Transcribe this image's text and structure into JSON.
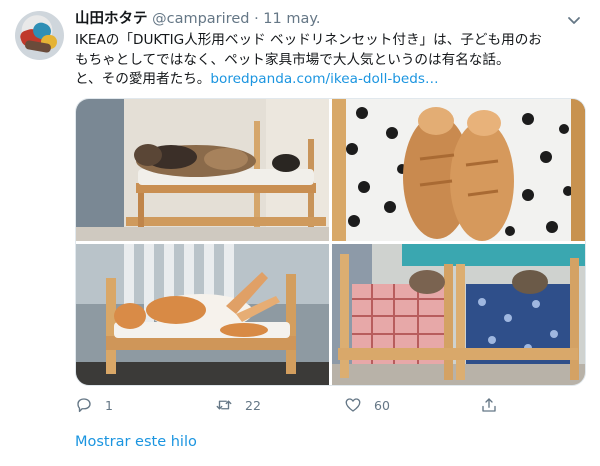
{
  "tweet": {
    "author_name": "山田ホタテ",
    "handle": "@camparired",
    "separator": "·",
    "date": "11 may.",
    "text_lines": [
      "IKEAの「DUKTIG人形用ベッド ベッドリネンセット付き」は、子ども用のお",
      "もちゃとしてではなく、ペット家具市場で大人気というのは有名な話。",
      "と、その愛用者たち。"
    ],
    "link": "boredpanda.com/ikea-doll-beds…",
    "photos": [
      {
        "icon": "photo-cat-shelf-bed"
      },
      {
        "icon": "photo-cats-polka-dot-bed"
      },
      {
        "icon": "photo-cat-sleeping-bed"
      },
      {
        "icon": "photo-two-cats-beds"
      }
    ]
  },
  "actions": {
    "reply_count": "1",
    "retweet_count": "22",
    "like_count": "60",
    "share_count": ""
  },
  "show_thread": "Mostrar este hilo",
  "colors": {
    "link": "#1b95e0",
    "muted": "#657786",
    "text": "#14171a",
    "border": "#e1e8ed"
  },
  "icons": [
    "caret-down-icon",
    "reply-icon",
    "retweet-icon",
    "like-icon",
    "share-icon"
  ]
}
